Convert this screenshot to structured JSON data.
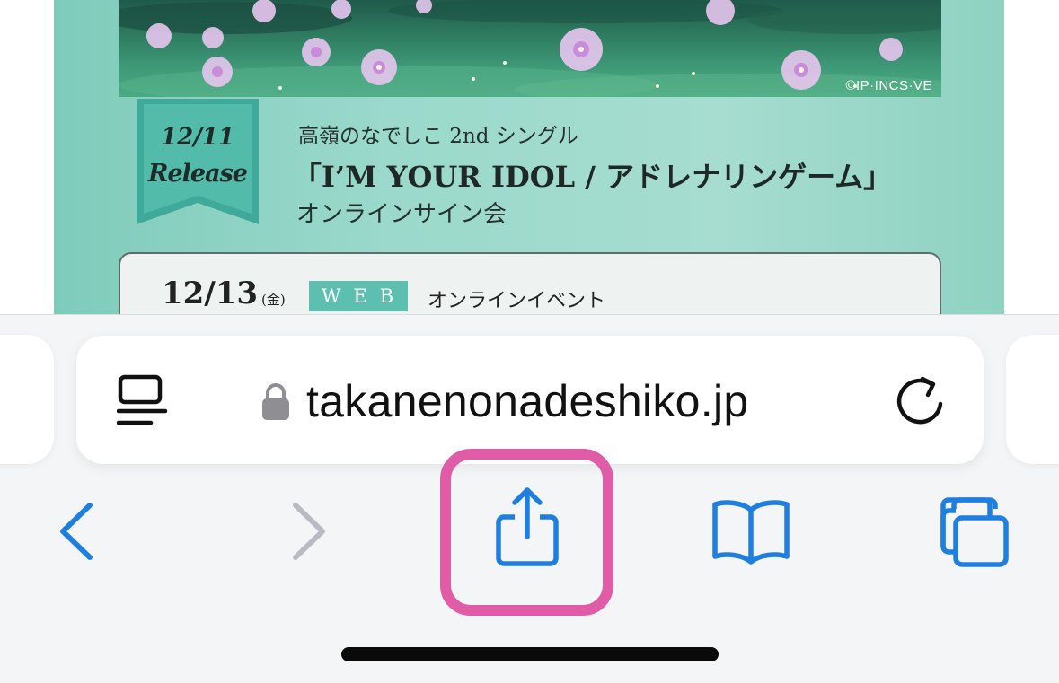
{
  "web_content": {
    "copyright": "©IP·INCS·VE",
    "release_tag": {
      "date": "12/11",
      "word": "Release"
    },
    "event": {
      "subtitle": "高嶺のなでしこ 2nd シングル",
      "title": "「I’M YOUR IDOL / アドレナリンゲーム」",
      "kind": "オンラインサイン会"
    },
    "schedule": {
      "date": "12/13",
      "day": "(金)",
      "badge": "WEB",
      "type": "オンラインイベント"
    }
  },
  "address_bar": {
    "url": "takanenonadeshiko.jp",
    "reader_icon": "reader-icon",
    "lock_icon": "lock-icon",
    "reload_icon": "reload-icon"
  },
  "toolbar": {
    "buttons": [
      "back-chevron-icon",
      "forward-chevron-icon",
      "share-icon",
      "bookmarks-book-icon",
      "tabs-icon"
    ],
    "forward_enabled": false
  },
  "colors": {
    "accent_blue": "#1f7fe0",
    "disabled_gray": "#b8bcc2",
    "highlight_pink": "#e05ca6",
    "page_teal": "#9ad9cb",
    "badge_teal": "#5dbfaf"
  }
}
